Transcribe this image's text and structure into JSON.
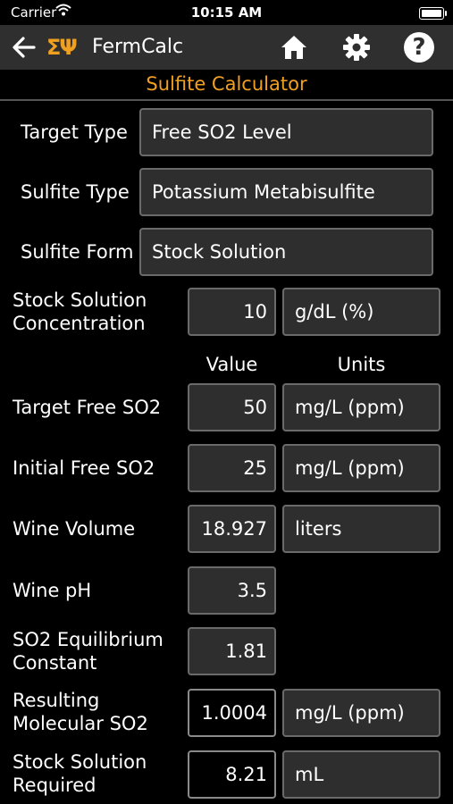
{
  "status": {
    "carrier": "Carrier",
    "time": "10:15 AM"
  },
  "navbar": {
    "logo": "ΣΨ",
    "title": "FermCalc"
  },
  "page_title": "Sulfite Calculator",
  "selectors": [
    {
      "label": "Target Type",
      "value": "Free SO2 Level"
    },
    {
      "label": "Sulfite Type",
      "value": "Potassium Metabisulfite"
    },
    {
      "label": "Sulfite Form",
      "value": "Stock Solution"
    }
  ],
  "stock": {
    "label_line1": "Stock Solution",
    "label_line2": "Concentration",
    "value": "10",
    "unit": "g/dL (%)"
  },
  "columns": {
    "value": "Value",
    "units": "Units"
  },
  "rows": {
    "target_free": {
      "label": "Target Free SO2",
      "value": "50",
      "unit": "mg/L (ppm)"
    },
    "initial_free": {
      "label": "Initial Free SO2",
      "value": "25",
      "unit": "mg/L (ppm)"
    },
    "wine_volume": {
      "label": "Wine Volume",
      "value": "18.927",
      "unit": "liters"
    },
    "wine_ph": {
      "label": "Wine pH",
      "value": "3.5"
    },
    "equilibrium": {
      "label_line1": "SO2 Equilibrium",
      "label_line2": "Constant",
      "value": "1.81"
    },
    "molecular": {
      "label_line1": "Resulting",
      "label_line2": "Molecular SO2",
      "value": "1.0004",
      "unit": "mg/L (ppm)"
    },
    "required": {
      "label_line1": "Stock Solution",
      "label_line2": "Required",
      "value": "8.21",
      "unit": "mL"
    }
  }
}
